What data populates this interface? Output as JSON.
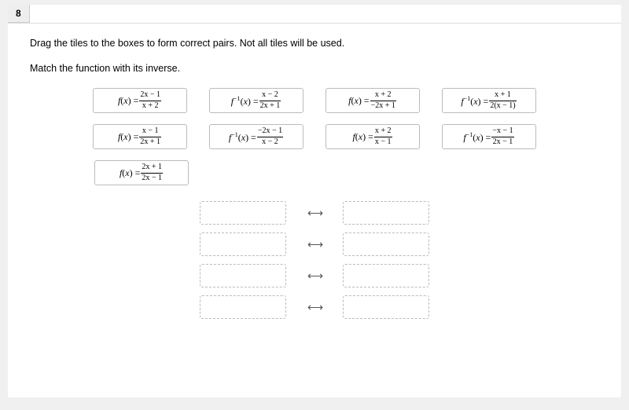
{
  "question_number": "8",
  "instruction1": "Drag the tiles to the boxes to form correct pairs. Not all tiles will be used.",
  "instruction2": "Match the function with its inverse.",
  "tiles": {
    "r1c1": {
      "lhs": "f(x) =",
      "num": "2x − 1",
      "den": "x + 2"
    },
    "r1c2": {
      "lhs": "f⁻¹(x) =",
      "num": "x − 2",
      "den": "2x + 1"
    },
    "r1c3": {
      "lhs": "f(x) =",
      "num": "x + 2",
      "den": "−2x + 1"
    },
    "r1c4": {
      "lhs": "f⁻¹(x) =",
      "num": "x + 1",
      "den": "2(x − 1)"
    },
    "r2c1": {
      "lhs": "f(x) =",
      "num": "x − 1",
      "den": "2x + 1"
    },
    "r2c2": {
      "lhs": "f⁻¹(x) =",
      "num": "−2x − 1",
      "den": "x − 2"
    },
    "r2c3": {
      "lhs": "f(x) =",
      "num": "x + 2",
      "den": "x − 1"
    },
    "r2c4": {
      "lhs": "f⁻¹(x) =",
      "num": "−x − 1",
      "den": "2x − 1"
    },
    "r3c1": {
      "lhs": "f(x) =",
      "num": "2x + 1",
      "den": "2x − 1"
    }
  },
  "arrow_glyph": "⟷",
  "pair_count": 4
}
